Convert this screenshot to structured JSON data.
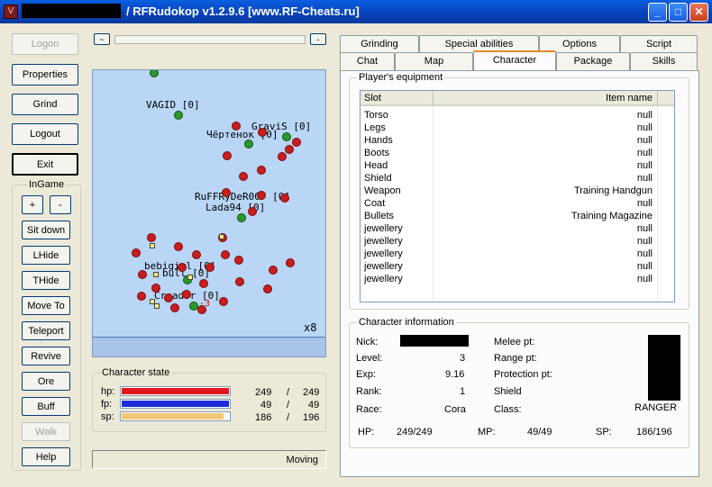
{
  "window": {
    "title": "/ RFRudokop v1.2.9.6 [www.RF-Cheats.ru]",
    "icon": "app-icon",
    "minimize": "_",
    "maximize": "□",
    "close": "✕"
  },
  "left_buttons": {
    "logon": "Logon",
    "properties": "Properties",
    "grind": "Grind",
    "logout": "Logout",
    "exit": "Exit"
  },
  "ingame": {
    "title": "InGame",
    "plus": "+",
    "minus": "-",
    "sit_down": "Sit down",
    "lhide": "LHide",
    "thide": "THide",
    "move_to": "Move To",
    "teleport": "Teleport",
    "revive": "Revive",
    "ore": "Ore",
    "buff": "Buff",
    "walk": "Walk",
    "help": "Help"
  },
  "map": {
    "zoom_out": "~",
    "zoom_in": "-",
    "zoom_label": "x8",
    "marker_text": "-3",
    "players": [
      "VAGID [0]",
      "GraviS [0]",
      "Чёртенок [0]",
      "RuFFRyDeR007 [0]",
      "Lada94 [0]",
      "bebigirl [0]",
      "bull [0]",
      "Creador [0]"
    ]
  },
  "character_state": {
    "title": "Character state",
    "hp": {
      "label": "hp:",
      "cur": "249",
      "sep": "/",
      "max": "249",
      "fraction": 1.0,
      "color": "#e0161b"
    },
    "fp": {
      "label": "fp:",
      "cur": "49",
      "sep": "/",
      "max": "49",
      "fraction": 1.0,
      "color": "#1c2ad8"
    },
    "sp": {
      "label": "sp:",
      "cur": "186",
      "sep": "/",
      "max": "196",
      "fraction": 0.949,
      "color": "#f0c878"
    }
  },
  "status": {
    "text": "Moving"
  },
  "tabs": {
    "row_back": [
      "Grinding",
      "Special abilities",
      "Options",
      "Script"
    ],
    "row_front": [
      "Chat",
      "Map",
      "Character",
      "Package",
      "Skills"
    ],
    "active": "Character"
  },
  "equipment": {
    "title": "Player's equipment",
    "columns": [
      "Slot",
      "Item name"
    ],
    "rows": [
      [
        "Torso",
        "null"
      ],
      [
        "Legs",
        "null"
      ],
      [
        "Hands",
        "null"
      ],
      [
        "Boots",
        "null"
      ],
      [
        "Head",
        "null"
      ],
      [
        "Shield",
        "null"
      ],
      [
        "Weapon",
        "Training Handgun"
      ],
      [
        "Coat",
        "null"
      ],
      [
        "Bullets",
        "Training Magazine"
      ],
      [
        "jewellery",
        "null"
      ],
      [
        "jewellery",
        "null"
      ],
      [
        "jewellery",
        "null"
      ],
      [
        "jewellery",
        "null"
      ],
      [
        "jewellery",
        "null"
      ]
    ]
  },
  "character_info": {
    "title": "Character information",
    "nick_label": "Nick:",
    "level_label": "Level:",
    "level": "3",
    "exp_label": "Exp:",
    "exp": "9.16",
    "rank_label": "Rank:",
    "rank": "1",
    "race_label": "Race:",
    "race": "Cora",
    "melee_label": "Melee pt:",
    "range_label": "Range pt:",
    "protection_label": "Protection pt:",
    "shield_label": "Shield",
    "class_label": "Class:",
    "class": "RANGER",
    "hp_label": "HP:",
    "hp": "249/249",
    "mp_label": "MP:",
    "mp": "49/49",
    "sp_label": "SP:",
    "sp": "186/196"
  }
}
